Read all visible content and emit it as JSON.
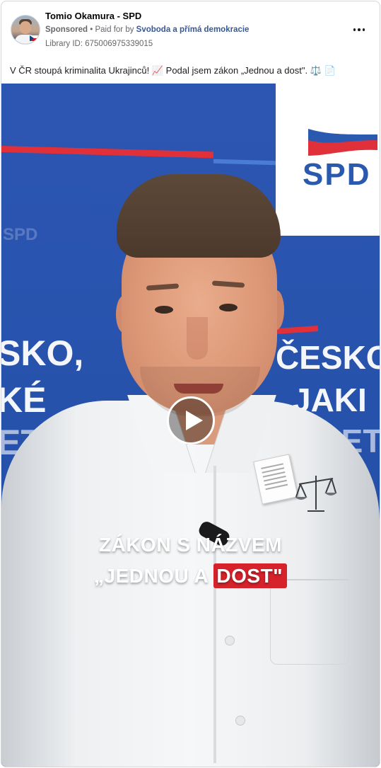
{
  "post": {
    "author": "Tomio Okamura - SPD",
    "sponsored": "Sponsored",
    "paid_for_prefix": "• Paid for by",
    "payer": "Svoboda a přímá demokracie",
    "library_id": "Library ID: 675006975339015",
    "caption_text": "V ČR stoupá kriminalita Ukrajinců! 📈 Podal jsem zákon „Jednou a dost\". ⚖️ 📄",
    "more_icon": "more-horizontal-icon"
  },
  "video": {
    "logo_text": "SPD",
    "faint_logo_text": "SPD",
    "wall_left": [
      "SKO,",
      "KÉ",
      "ETE"
    ],
    "wall_right": [
      "ČESKO",
      "JAKI",
      "SETE"
    ],
    "headline_line1": "ZÁKON S NÁZVEM",
    "headline_line2_prefix": "„JEDNOU A ",
    "headline_line2_highlight": "DOST",
    "headline_line2_suffix": "\"",
    "play_icon": "play-icon",
    "stickers": [
      "document-icon",
      "scales-icon"
    ],
    "colors": {
      "backdrop_blue": "#2753ad",
      "brand_red": "#e0303a",
      "highlight_red": "#d6222b"
    }
  }
}
